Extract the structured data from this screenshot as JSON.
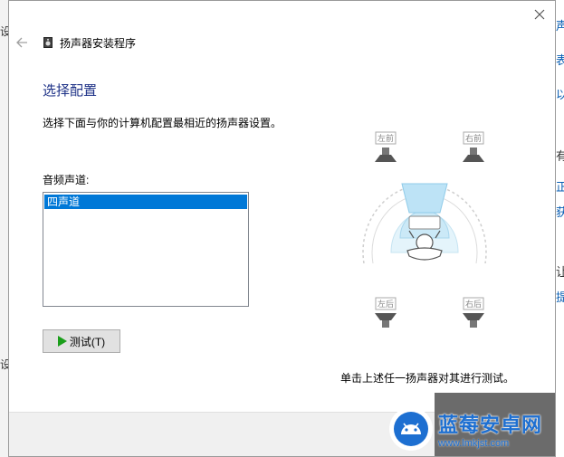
{
  "window": {
    "title": "扬声器安装程序",
    "heading": "选择配置",
    "instruction": "选择下面与你的计算机配置最相近的扬声器设置。"
  },
  "channels": {
    "label": "音频声道:",
    "items": [
      "四声道"
    ],
    "selected": "四声道"
  },
  "buttons": {
    "test_label": "测试(T)"
  },
  "diagram": {
    "front_left": "左前",
    "front_right": "右前",
    "rear_left": "左后",
    "rear_right": "右后"
  },
  "hint": "单击上述任一扬声器对其进行测试。",
  "background_fragments": {
    "left": [
      "设",
      "设"
    ],
    "right": [
      "声",
      "表",
      "以",
      "有",
      "正",
      "获",
      "让",
      "提"
    ]
  },
  "watermark": {
    "title": "蓝莓安卓网",
    "url": "www.lmkjst.com"
  },
  "colors": {
    "accent": "#0078d7",
    "heading": "#1e3287",
    "play": "#1a9e1a"
  }
}
